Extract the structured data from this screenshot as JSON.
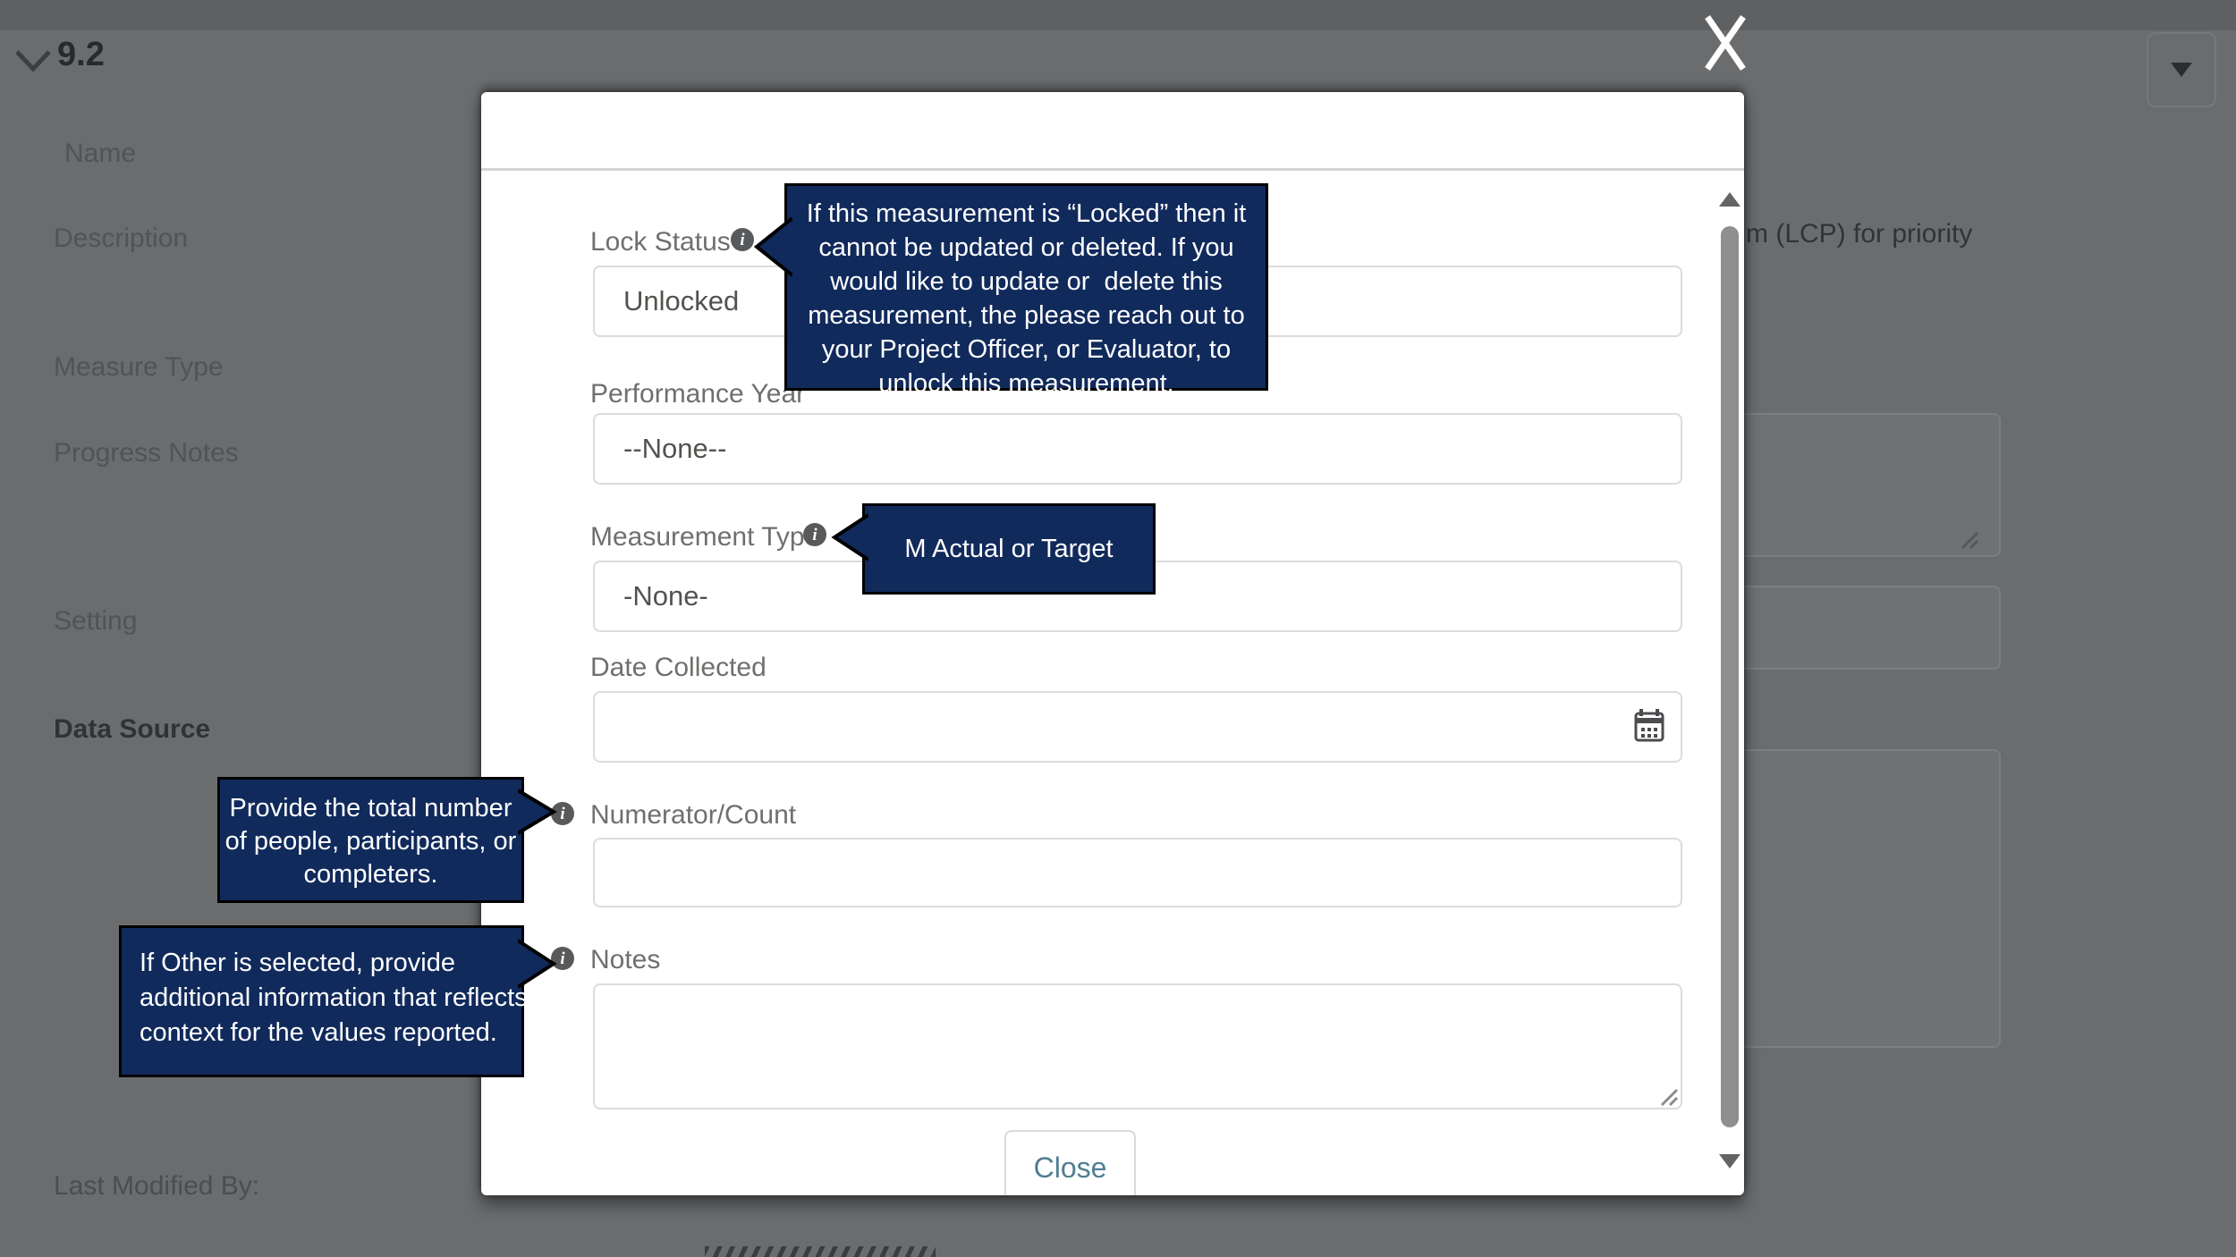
{
  "backdrop": {
    "section_number": "9.2",
    "labels": {
      "name": "Name",
      "description": "Description",
      "measure_type": "Measure Type",
      "progress_notes": "Progress Notes",
      "setting": "Setting",
      "data_source": "Data Source",
      "last_modified_by": "Last Modified By:"
    },
    "description_value_visible": "m (LCP) for priority"
  },
  "modal": {
    "lock_status": {
      "label": "Lock Status",
      "value": "Unlocked"
    },
    "performance_year": {
      "label": "Performance Year",
      "value": "--None--"
    },
    "measurement_type": {
      "label": "Measurement Type",
      "value": "-None-"
    },
    "date_collected": {
      "label": "Date Collected",
      "value": ""
    },
    "numerator_count": {
      "label": "Numerator/Count",
      "value": ""
    },
    "notes": {
      "label": "Notes",
      "value": ""
    },
    "close_label": "Close"
  },
  "tooltips": {
    "lock_status": {
      "lines": [
        "If this measurement is “Locked” then it",
        "cannot be updated or deleted. If you",
        "would like to update or  delete this",
        "measurement, the please reach out to",
        "your Project Officer, or Evaluator, to",
        "unlock this measurement."
      ]
    },
    "measurement_type": {
      "lines": [
        "M Actual or Target"
      ]
    },
    "numerator_count": {
      "lines": [
        "Provide the total number",
        "of people, participants, or",
        "completers."
      ]
    },
    "notes": {
      "lines": [
        "If Other is selected, provide",
        "additional information that reflects",
        "context for the values reported."
      ]
    }
  },
  "colors": {
    "tooltip_navy": "#112a5c",
    "overlay_gray": "#6a6c6e",
    "close_button_text": "#4f7e91",
    "info_icon_gray": "#58595b",
    "input_border": "#dddbda"
  }
}
